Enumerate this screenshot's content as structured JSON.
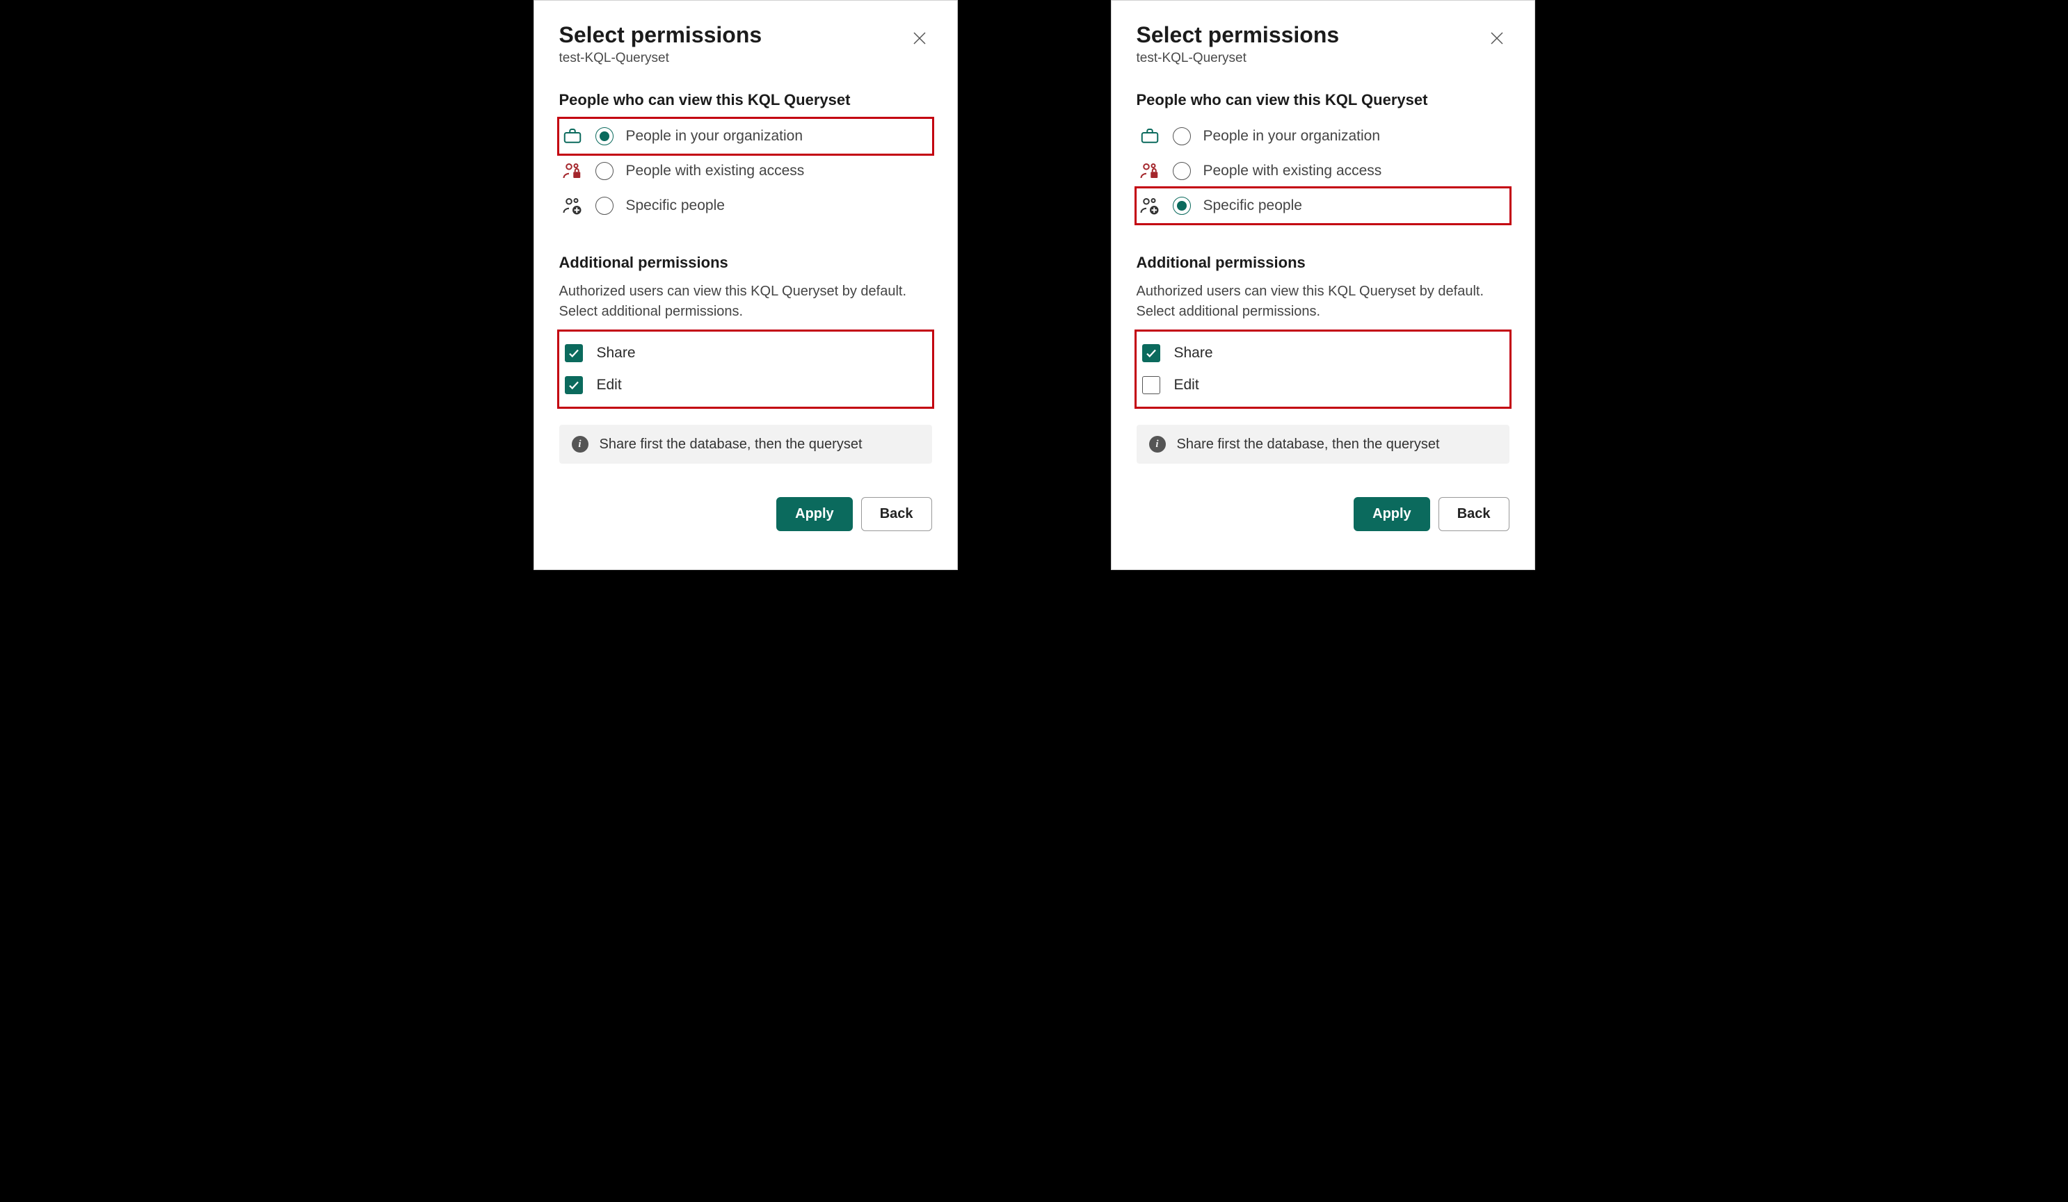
{
  "left": {
    "title": "Select permissions",
    "subtitle": "test-KQL-Queryset",
    "view_heading": "People who can view this KQL Queryset",
    "radios": {
      "org": {
        "label": "People in your organization",
        "checked": true,
        "highlight": true
      },
      "existing": {
        "label": "People with existing access",
        "checked": false,
        "highlight": false
      },
      "specific": {
        "label": "Specific people",
        "checked": false,
        "highlight": false
      }
    },
    "perms_heading": "Additional permissions",
    "perms_desc": "Authorized users can view this KQL Queryset by default. Select additional permissions.",
    "checkboxes": {
      "share": {
        "label": "Share",
        "checked": true
      },
      "edit": {
        "label": "Edit",
        "checked": true
      }
    },
    "checkbox_highlight": true,
    "info": "Share first the database, then the queryset",
    "apply": "Apply",
    "back": "Back"
  },
  "right": {
    "title": "Select permissions",
    "subtitle": "test-KQL-Queryset",
    "view_heading": "People who can view this KQL Queryset",
    "radios": {
      "org": {
        "label": "People in your organization",
        "checked": false,
        "highlight": false
      },
      "existing": {
        "label": "People with existing access",
        "checked": false,
        "highlight": false
      },
      "specific": {
        "label": "Specific people",
        "checked": true,
        "highlight": true
      }
    },
    "perms_heading": "Additional permissions",
    "perms_desc": "Authorized users can view this KQL Queryset by default. Select additional permissions.",
    "checkboxes": {
      "share": {
        "label": "Share",
        "checked": true
      },
      "edit": {
        "label": "Edit",
        "checked": false
      }
    },
    "checkbox_highlight": true,
    "info": "Share first the database, then the queryset",
    "apply": "Apply",
    "back": "Back"
  }
}
